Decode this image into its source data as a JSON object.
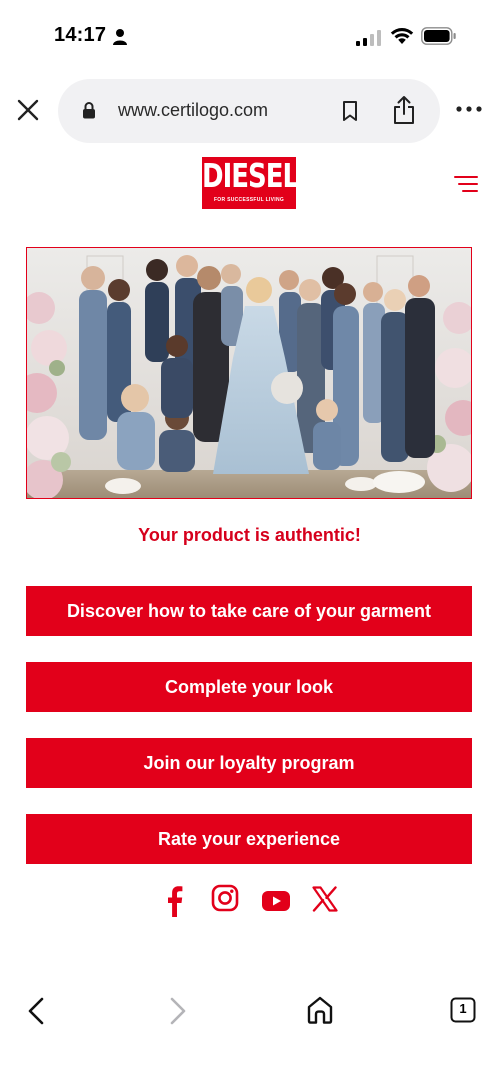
{
  "status_bar": {
    "time": "14:17"
  },
  "browser": {
    "url": "www.certilogo.com",
    "tab_count": "1"
  },
  "brand": {
    "logo_text": "DIESEL",
    "logo_tagline": "FOR SUCCESSFUL LIVING",
    "accent_color": "#e2001a"
  },
  "main": {
    "auth_message": "Your product is authentic!",
    "buttons": [
      {
        "label": "Discover how to take care of your garment"
      },
      {
        "label": "Complete your look"
      },
      {
        "label": "Join our loyalty program"
      },
      {
        "label": "Rate your experience"
      }
    ]
  },
  "social": {
    "icons": [
      "facebook-icon",
      "instagram-icon",
      "youtube-icon",
      "x-icon"
    ]
  },
  "toolbar": {
    "icons": [
      "back-icon",
      "forward-icon",
      "home-icon",
      "tabs-icon"
    ]
  }
}
